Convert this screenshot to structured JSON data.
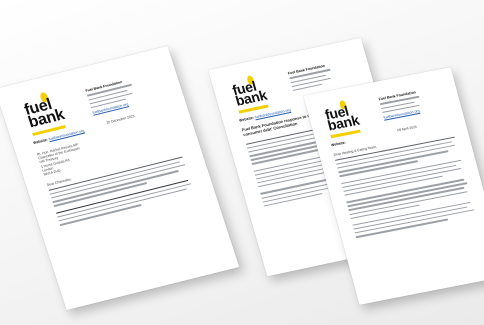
{
  "org": {
    "logo_word_1": "fuel",
    "logo_word_2": "bank",
    "name": "Fuel Bank Foundation",
    "website_label": "Website:",
    "website_url": "fuelbankfoundation.org"
  },
  "letters": {
    "left": {
      "date": "20 December 2023",
      "greeting": "Dear Chancellor,",
      "address_lines": [
        "Rt. Hon. Rachel Reeves MP",
        "Chancellor of the Exchequer",
        "HM Treasury",
        "1 Horse Guards Rd",
        "London",
        "SW1A 2HQ"
      ]
    },
    "middle": {
      "title": "Fuel Bank Foundation response to Ofgem's 'Debt Relief and consumer debt' Consultation"
    },
    "right": {
      "date": "08 April 2024",
      "greeting": "Dear Heating & Eating Team,"
    }
  },
  "colors": {
    "brand_yellow": "#f4d000",
    "link_blue": "#2a5db0"
  }
}
